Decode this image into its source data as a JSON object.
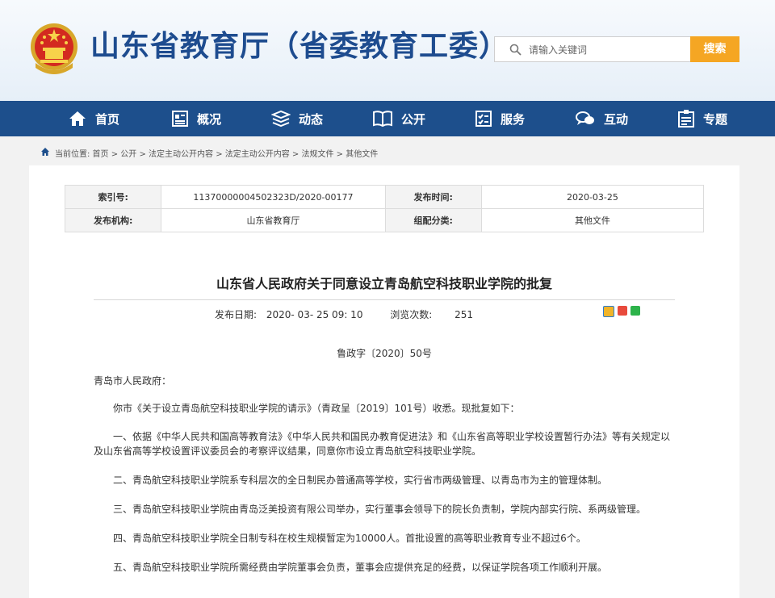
{
  "header": {
    "site_title": "山东省教育厅（省委教育工委）",
    "search_placeholder": "请输入关键词",
    "search_button": "搜索"
  },
  "nav": {
    "items": [
      {
        "label": "首页",
        "icon": "home-icon"
      },
      {
        "label": "概况",
        "icon": "overview-icon"
      },
      {
        "label": "动态",
        "icon": "news-stack-icon"
      },
      {
        "label": "公开",
        "icon": "open-book-icon"
      },
      {
        "label": "服务",
        "icon": "service-checklist-icon"
      },
      {
        "label": "互动",
        "icon": "chat-bubbles-icon"
      },
      {
        "label": "专题",
        "icon": "topic-board-icon"
      }
    ]
  },
  "breadcrumb": {
    "text": "当前位置: 首页 > 公开 > 法定主动公开内容 > 法定主动公开内容 > 法规文件 > 其他文件"
  },
  "meta": {
    "index_label": "索引号:",
    "index_value": "11370000004502323D/2020-00177",
    "publish_time_label": "发布时间:",
    "publish_time_value": "2020-03-25",
    "publisher_label": "发布机构:",
    "publisher_value": "山东省教育厅",
    "category_label": "组配分类:",
    "category_value": "其他文件"
  },
  "article": {
    "title": "山东省人民政府关于同意设立青岛航空科技职业学院的批复",
    "publish_date_label": "发布日期:",
    "publish_date_value": "2020- 03- 25 09: 10",
    "views_label": "浏览次数:",
    "views_value": "251",
    "doc_number": "鲁政字〔2020〕50号",
    "salutation": "青岛市人民政府：",
    "paragraphs": [
      "你市《关于设立青岛航空科技职业学院的请示》（青政呈〔2019〕101号）收悉。现批复如下：",
      "一、依据《中华人民共和国高等教育法》《中华人民共和国民办教育促进法》和《山东省高等职业学校设置暂行办法》等有关规定以及山东省高等学校设置评议委员会的考察评议结果，同意你市设立青岛航空科技职业学院。",
      "二、青岛航空科技职业学院系专科层次的全日制民办普通高等学校，实行省市两级管理、以青岛市为主的管理体制。",
      "三、青岛航空科技职业学院由青岛泛美投资有限公司举办，实行董事会领导下的院长负责制，学院内部实行院、系两级管理。",
      "四、青岛航空科技职业学院全日制专科在校生规模暂定为10000人。首批设置的高等职业教育专业不超过6个。",
      "五、青岛航空科技职业学院所需经费由学院董事会负责，董事会应提供充足的经费，以保证学院各项工作顺利开展。"
    ]
  },
  "colors": {
    "brand_blue": "#1d4f8c",
    "title_blue": "#1e4c8f",
    "search_orange": "#f5a623"
  }
}
